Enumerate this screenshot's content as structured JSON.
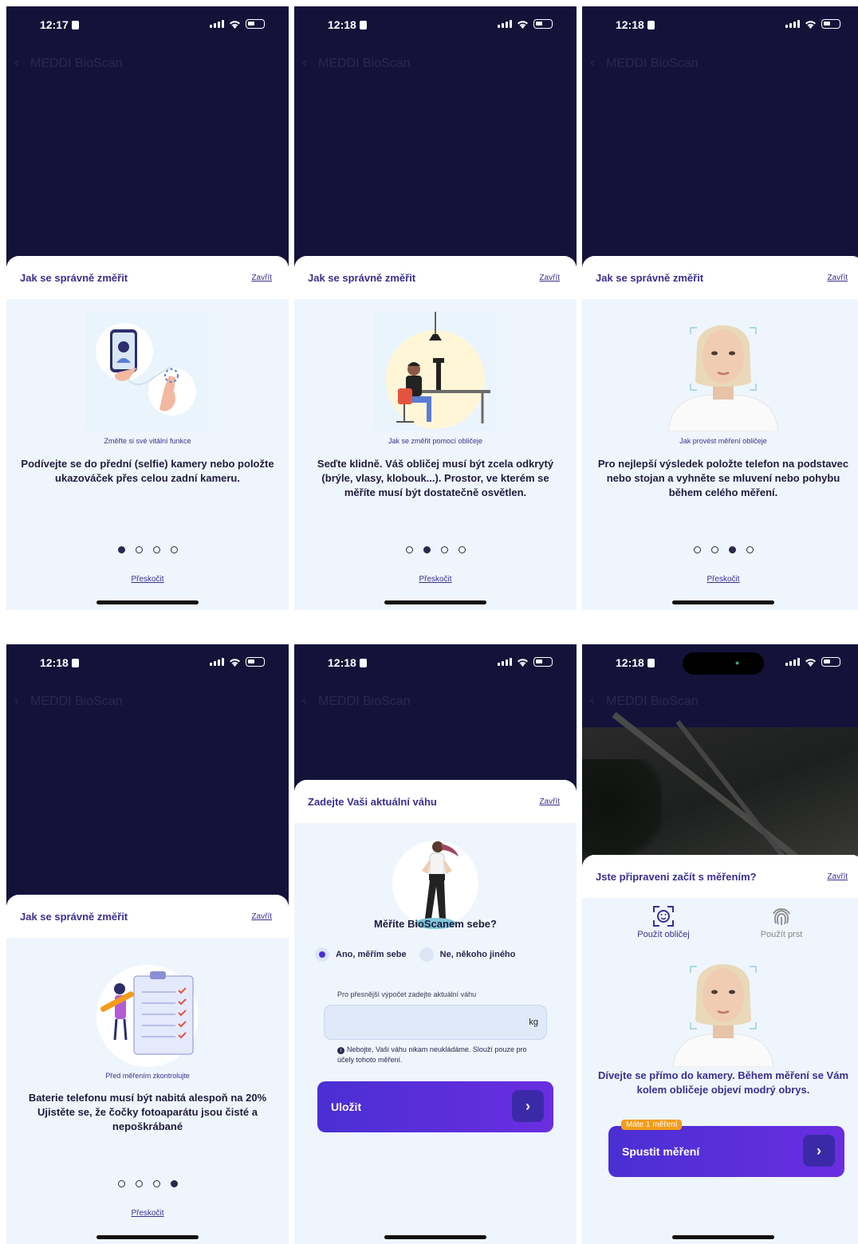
{
  "status_bar": {
    "times": [
      "12:17",
      "12:18",
      "12:18",
      "12:18",
      "12:18",
      "12:18"
    ]
  },
  "app": {
    "title": "MEDDI BioScan",
    "back_icon": "chevron-left-icon"
  },
  "tutorial": {
    "sheet_title": "Jak se správně změřit",
    "close_label": "Zavřít",
    "skip_label": "Přeskočit",
    "steps": [
      {
        "caption": "Změřte si své vitální funkce",
        "text": "Podívejte se do přední (selfie) kamery nebo položte ukazováček přes celou zadní kameru.",
        "illustration": "phone-finger-illustration",
        "active_dot": 0
      },
      {
        "caption": "Jak se změřit pomocí obličeje",
        "text": "Seďte klidně. Váš obličej musí být zcela odkrytý (brýle, vlasy, klobouk...). Prostor, ve kterém se měříte musí být dostatečně osvětlen.",
        "illustration": "man-at-desk-illustration",
        "active_dot": 1
      },
      {
        "caption": "Jak provést měření obličeje",
        "text": "Pro nejlepší výsledek položte telefon na podstavec nebo stojan a vyhněte se mluvení nebo pohybu během celého měření.",
        "illustration": "face-photo",
        "active_dot": 2
      },
      {
        "caption": "Před měřením zkontrolujte",
        "text_line1": "Baterie telefonu musí být nabitá alespoň na 20%",
        "text_line2": "Ujistěte se, že čočky fotoaparátu jsou čisté a nepoškrábané",
        "illustration": "checklist-illustration",
        "active_dot": 3
      }
    ]
  },
  "weight_form": {
    "sheet_title": "Zadejte Vaši aktuální váhu",
    "close_label": "Zavřít",
    "question": "Měříte BioScanem sebe?",
    "options": [
      {
        "label": "Ano, měřím sebe",
        "selected": true
      },
      {
        "label": "Ne, někoho jiného",
        "selected": false
      }
    ],
    "input_label": "Pro přesnější výpočet zadejte aktuální váhu",
    "input_value": "",
    "unit": "kg",
    "note": "Nebojte, Vaši váhu nikam neukládáme. Slouží pouze pro účely tohoto měření.",
    "save_label": "Uložit"
  },
  "ready": {
    "sheet_title": "Jste připraveni začít s měřením?",
    "close_label": "Zavřít",
    "mode_face": "Použít obličej",
    "mode_finger": "Použít prst",
    "text": "Dívejte se přímo do kamery. Během měření se Vám kolem obličeje objeví modrý obrys.",
    "badge": "Máte 1 měření",
    "start_label": "Spustit měření"
  },
  "colors": {
    "header_bg": "#15123a",
    "sheet_bg": "#eff5fd",
    "accent": "#3a2f8f",
    "button": "#4a2fd3",
    "badge": "#f39c1a"
  }
}
